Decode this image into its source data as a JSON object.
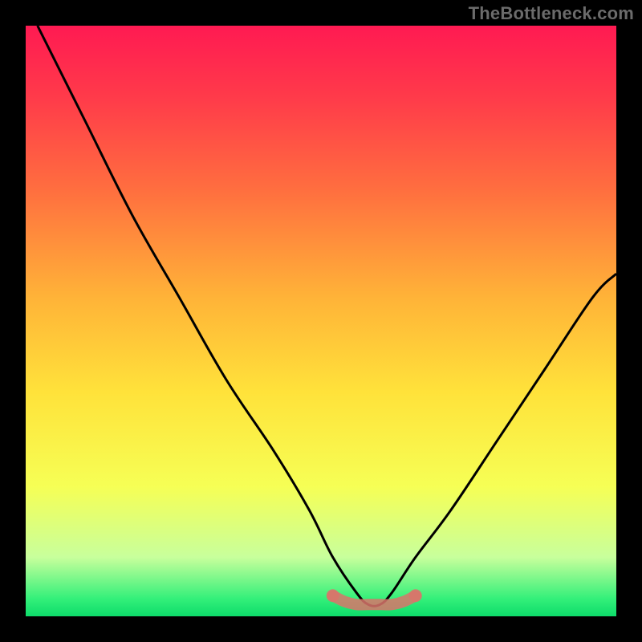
{
  "branding": {
    "watermark": "TheBottleneck.com"
  },
  "chart_data": {
    "type": "line",
    "title": "",
    "xlabel": "",
    "ylabel": "",
    "xlim": [
      0,
      100
    ],
    "ylim": [
      0,
      100
    ],
    "grid": false,
    "legend": false,
    "background": {
      "gradient_vertical": [
        {
          "pos": 0.0,
          "color": "#ff1a52"
        },
        {
          "pos": 0.12,
          "color": "#ff3a4a"
        },
        {
          "pos": 0.28,
          "color": "#ff6f3f"
        },
        {
          "pos": 0.46,
          "color": "#ffb338"
        },
        {
          "pos": 0.62,
          "color": "#ffe23a"
        },
        {
          "pos": 0.78,
          "color": "#f6ff55"
        },
        {
          "pos": 0.9,
          "color": "#c8ff9c"
        },
        {
          "pos": 0.97,
          "color": "#34f07a"
        },
        {
          "pos": 1.0,
          "color": "#0ddc6a"
        }
      ]
    },
    "series": [
      {
        "name": "bottleneck-curve",
        "color": "#000000",
        "x": [
          2,
          10,
          18,
          26,
          34,
          42,
          48,
          52,
          56,
          58,
          60,
          62,
          66,
          72,
          80,
          88,
          96,
          100
        ],
        "y": [
          100,
          84,
          68,
          54,
          40,
          28,
          18,
          10,
          4,
          2,
          2,
          4,
          10,
          18,
          30,
          42,
          54,
          58
        ]
      },
      {
        "name": "optimal-band",
        "color": "#d9746b",
        "x": [
          52,
          54,
          56,
          58,
          60,
          62,
          64,
          66
        ],
        "y": [
          3.5,
          2.5,
          2,
          2,
          2,
          2,
          2.5,
          3.5
        ]
      }
    ],
    "annotations": []
  }
}
